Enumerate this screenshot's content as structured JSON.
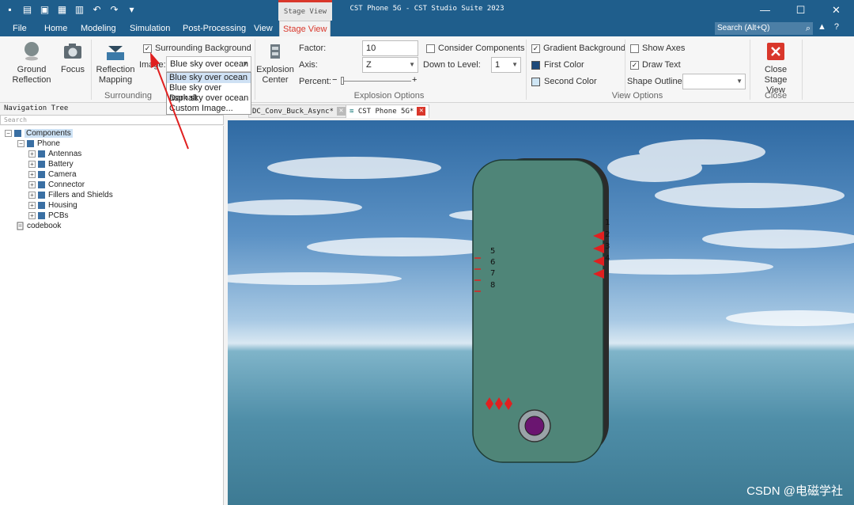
{
  "window": {
    "title": "CST Phone 5G - CST Studio Suite 2023",
    "context_tab": "Stage View"
  },
  "menu": {
    "tabs": [
      "File",
      "Home",
      "Modeling",
      "Simulation",
      "Post-Processing",
      "View",
      "Stage View"
    ],
    "active": "Stage View",
    "search_placeholder": "Search (Alt+Q)"
  },
  "ribbon": {
    "ground_reflection": "Ground\nReflection",
    "focus": "Focus",
    "reflection_mapping": "Reflection\nMapping",
    "surrounding_background": "Surrounding Background",
    "surrounding_background_checked": true,
    "image_label": "Image:",
    "image_value": "Blue sky over ocean",
    "group_surrounding": "Surrounding",
    "explosion_center": "Explosion\nCenter",
    "factor_label": "Factor:",
    "factor_value": "10",
    "axis_label": "Axis:",
    "axis_value": "Z",
    "percent_label": "Percent:",
    "consider_components": "Consider Components",
    "down_to_level_label": "Down to Level:",
    "down_to_level_value": "1",
    "group_explosion": "Explosion Options",
    "gradient_background": "Gradient Background",
    "first_color": "First Color",
    "second_color": "Second Color",
    "show_axes": "Show Axes",
    "draw_text": "Draw Text",
    "shape_outline_label": "Shape Outline:",
    "group_view": "View Options",
    "close_stage_view": "Close Stage\nView",
    "group_close": "Close"
  },
  "dropdown_options": [
    "Blue sky over ocean",
    "Blue sky over asphalt",
    "Dark sky over ocean",
    "Custom Image..."
  ],
  "nav": {
    "title": "Navigation Tree",
    "search_placeholder": "Search",
    "root": "Components",
    "phone": "Phone",
    "children": [
      "Antennas",
      "Battery",
      "Camera",
      "Connector",
      "Fillers and Shields",
      "Housing",
      "PCBs"
    ],
    "codebook": "codebook"
  },
  "doc_tabs": [
    "DC_Conv_Buck_Async*",
    "CST Phone 5G*"
  ],
  "viewport": {
    "labels_right": [
      "1",
      "2",
      "3",
      "4"
    ],
    "labels_left": [
      "5",
      "6",
      "7",
      "8"
    ],
    "watermark": "CSDN @电磁学社"
  },
  "colors": {
    "title_bar": "#1f5e8c",
    "accent_red": "#d9372b",
    "phone_body": "#4f8578",
    "camera": "#6a1570"
  }
}
